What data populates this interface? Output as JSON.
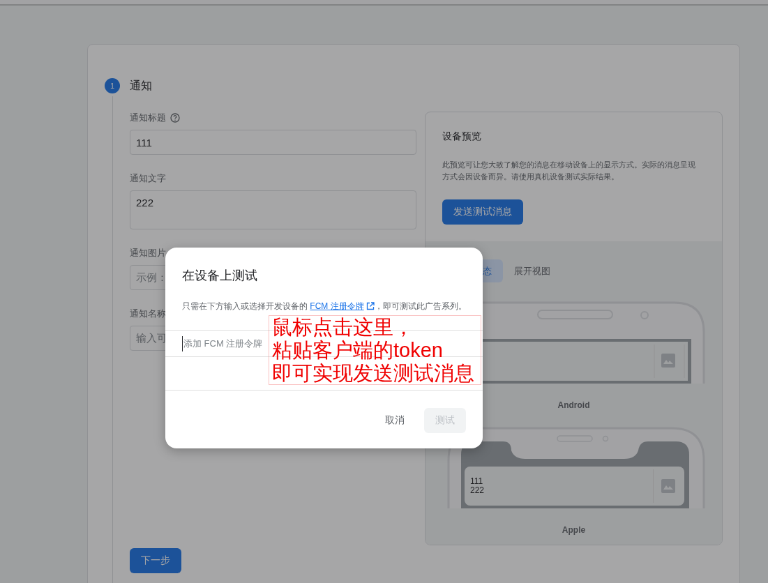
{
  "step": {
    "number": "1",
    "title": "通知"
  },
  "form": {
    "fields": [
      {
        "kind": "input",
        "label": "通知标题",
        "help": true,
        "value": "111"
      },
      {
        "kind": "textarea",
        "label": "通知文字",
        "help": false,
        "value": "222"
      },
      {
        "kind": "input",
        "label": "通知图片",
        "help": false,
        "placeholder": "示例："
      },
      {
        "kind": "input",
        "label": "通知名称",
        "help": false,
        "placeholder": "输入可"
      }
    ],
    "next_button": "下一步"
  },
  "preview": {
    "title": "设备预览",
    "description": "此预览可让您大致了解您的消息在移动设备上的显示方式。实际的消息呈现方式会因设备而异。请使用真机设备测试实际结果。",
    "send_button": "发送测试消息",
    "tabs": [
      {
        "label": "态",
        "selected": true
      },
      {
        "label": "展开视图",
        "selected": false
      }
    ],
    "devices": [
      {
        "kind": "android",
        "name": "Android"
      },
      {
        "kind": "apple",
        "name": "Apple",
        "title": "111",
        "body": "222"
      }
    ]
  },
  "dialog": {
    "title": "在设备上测试",
    "description_before": "只需在下方输入或选择开发设备的 ",
    "link": "FCM 注册令牌",
    "description_after": "，即可测试此广告系列。",
    "token_placeholder": "添加 FCM 注册令牌",
    "buttons": [
      {
        "label": "取消",
        "disabled": false
      },
      {
        "label": "测试",
        "disabled": true
      }
    ]
  },
  "annotation": {
    "lines": [
      "鼠标点击这里，",
      "粘贴客户端的token",
      "即可实现发送测试消息"
    ]
  }
}
